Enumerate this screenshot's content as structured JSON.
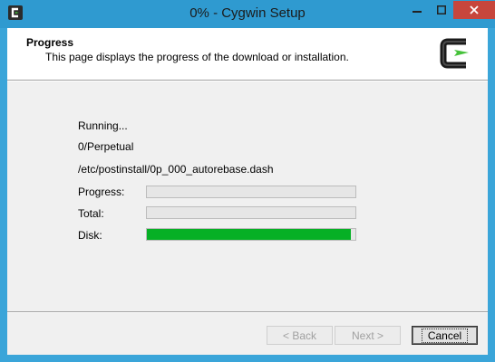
{
  "window": {
    "title": "0% - Cygwin Setup",
    "controls": {
      "minimize": "–",
      "maximize": "□",
      "close": "✕"
    }
  },
  "header": {
    "title": "Progress",
    "subtitle": "This page displays the progress of the download or installation.",
    "logo_icon": "cygwin-logo-icon"
  },
  "status": {
    "line1": "Running...",
    "line2": "0/Perpetual",
    "line3": "/etc/postinstall/0p_000_autorebase.dash"
  },
  "progress": {
    "rows": [
      {
        "label": "Progress:",
        "value": 0
      },
      {
        "label": "Total:",
        "value": 0
      },
      {
        "label": "Disk:",
        "value": 0.98
      }
    ]
  },
  "buttons": {
    "back": "< Back",
    "next": "Next >",
    "cancel": "Cancel"
  },
  "colors": {
    "progress_fill": "#06b025",
    "titlebar": "#2f9ad0",
    "close_button": "#c7463c"
  }
}
